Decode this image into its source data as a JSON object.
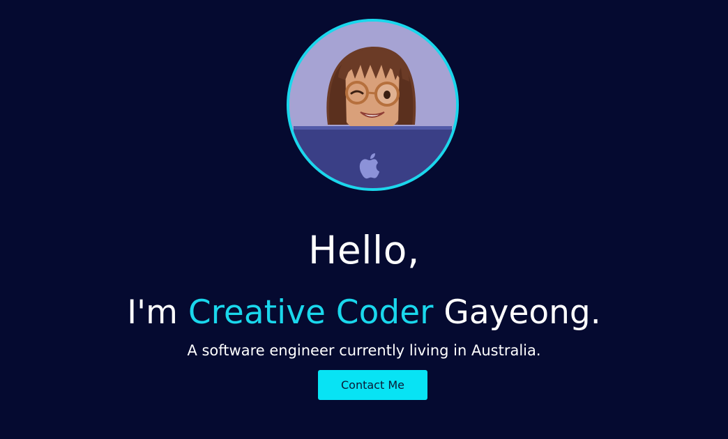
{
  "hero": {
    "avatar_alt": "Memoji avatar with glasses behind a laptop",
    "greeting": "Hello,",
    "intro_prefix": "I'm",
    "intro_highlight": "Creative Coder",
    "intro_suffix": "Gayeong.",
    "tagline": "A software engineer currently living in Australia.",
    "contact_label": "Contact Me"
  },
  "icons": {
    "laptop_logo": "apple-logo-icon"
  },
  "colors": {
    "background": "#050a30",
    "accent": "#1ad7ec",
    "button": "#08e3f4",
    "button_text": "#0b1a35",
    "text": "#ffffff"
  }
}
